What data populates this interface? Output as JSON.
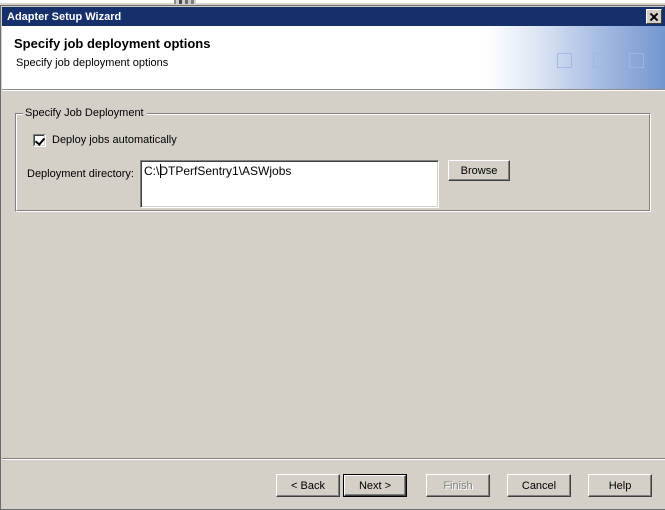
{
  "window": {
    "title": "Adapter Setup Wizard",
    "close_icon": "close-icon",
    "close_label": "X"
  },
  "header": {
    "title": "Specify job deployment options",
    "subtitle": "Specify job deployment options",
    "decoration": "three-squares-gradient"
  },
  "main": {
    "groupbox": {
      "legend": "Specify Job Deployment",
      "checkbox": {
        "label": "Deploy jobs automatically",
        "checked": true
      },
      "directory": {
        "label": "Deployment directory:",
        "value": "C:\\DTPerfSentry1\\ASWjobs",
        "placeholder": "",
        "caret_visible": true
      },
      "browse_button": "Browse"
    }
  },
  "footer": {
    "buttons": [
      {
        "label": "< Back",
        "state": "enabled"
      },
      {
        "label": "Next >",
        "state": "default"
      },
      {
        "label": "Finish",
        "state": "disabled"
      },
      {
        "label": "Cancel",
        "state": "enabled"
      },
      {
        "label": "Help",
        "state": "enabled"
      }
    ]
  },
  "colors": {
    "titlebar": "#16306c",
    "face": "#d4d0c8",
    "header_bg": "#ffffff",
    "gradient_end": "#7496d0",
    "text": "#000000",
    "disabled_text": "#808080"
  }
}
